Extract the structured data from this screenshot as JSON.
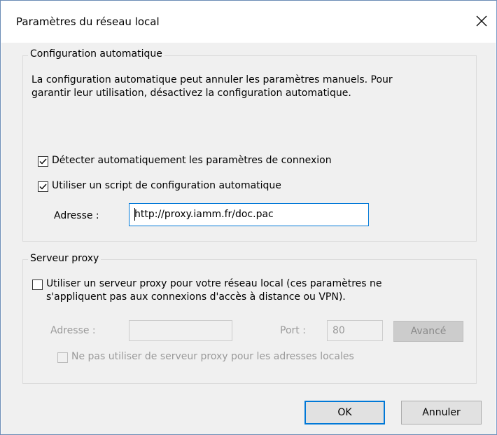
{
  "window": {
    "title": "Paramètres du réseau local",
    "close_icon": "close-icon"
  },
  "auto_config": {
    "group_title": "Configuration automatique",
    "description_line1": "La configuration automatique peut annuler les paramètres manuels. Pour",
    "description_line2": "garantir leur utilisation, désactivez la configuration automatique.",
    "detect_checkbox": {
      "label": "Détecter automatiquement les paramètres de connexion",
      "checked": true
    },
    "script_checkbox": {
      "label": "Utiliser un script de configuration automatique",
      "checked": true
    },
    "address_label": "Adresse :",
    "address_value": "http://proxy.iamm.fr/doc.pac"
  },
  "proxy": {
    "group_title": "Serveur proxy",
    "use_proxy_checkbox": {
      "label_line1": "Utiliser un serveur proxy pour votre réseau local (ces paramètres ne",
      "label_line2": "s'appliquent pas aux connexions d'accès à distance ou VPN).",
      "checked": false
    },
    "address_label": "Adresse :",
    "address_value": "",
    "port_label": "Port :",
    "port_value": "80",
    "advanced_button": "Avancé",
    "bypass_local_checkbox": {
      "label": "Ne pas utiliser de serveur proxy pour les adresses locales",
      "checked": false
    }
  },
  "footer": {
    "ok_button": "OK",
    "cancel_button": "Annuler"
  },
  "colors": {
    "accent": "#0078d7",
    "panel_background": "#f0f0f0",
    "disabled_text": "#9a9a9a"
  }
}
